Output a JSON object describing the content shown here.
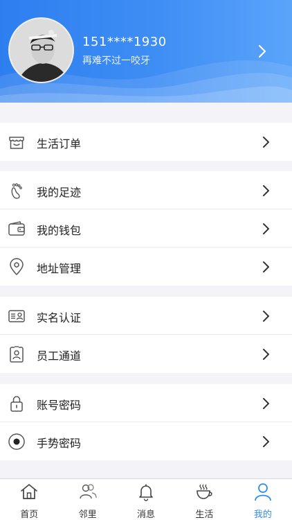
{
  "profile": {
    "phone": "151****1930",
    "bio": "再难不过一咬牙"
  },
  "menu": {
    "group1": [
      {
        "label": "生活订单",
        "icon": "shop-icon"
      }
    ],
    "group2": [
      {
        "label": "我的足迹",
        "icon": "footprint-icon"
      },
      {
        "label": "我的钱包",
        "icon": "wallet-icon"
      },
      {
        "label": "地址管理",
        "icon": "location-pin-icon"
      }
    ],
    "group3": [
      {
        "label": "实名认证",
        "icon": "id-card-icon"
      },
      {
        "label": "员工通道",
        "icon": "employee-badge-icon"
      }
    ],
    "group4": [
      {
        "label": "账号密码",
        "icon": "lock-icon"
      },
      {
        "label": "手势密码",
        "icon": "gesture-icon"
      }
    ]
  },
  "tabbar": {
    "items": [
      {
        "label": "首页",
        "icon": "home-icon"
      },
      {
        "label": "邻里",
        "icon": "neighbors-icon"
      },
      {
        "label": "消息",
        "icon": "bell-icon"
      },
      {
        "label": "生活",
        "icon": "coffee-cup-icon"
      },
      {
        "label": "我的",
        "icon": "user-icon"
      }
    ],
    "active_index": 4,
    "active_color": "#2d8cf0"
  },
  "colors": {
    "header_start": "#2d7ff0",
    "header_end": "#5aa4fa",
    "background": "#f4f4f8"
  }
}
